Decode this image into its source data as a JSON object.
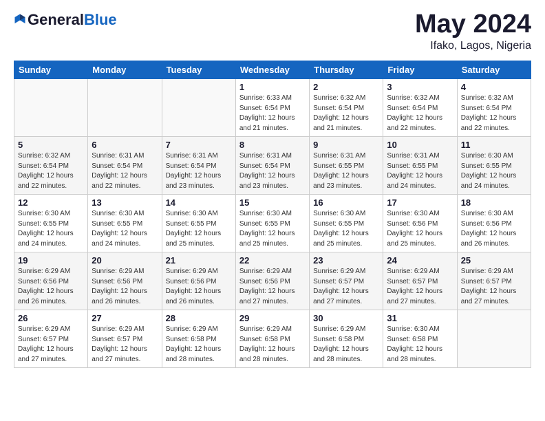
{
  "header": {
    "logo_general": "General",
    "logo_blue": "Blue",
    "title": "May 2024",
    "location": "Ifako, Lagos, Nigeria"
  },
  "days_of_week": [
    "Sunday",
    "Monday",
    "Tuesday",
    "Wednesday",
    "Thursday",
    "Friday",
    "Saturday"
  ],
  "weeks": [
    [
      {
        "day": "",
        "info": ""
      },
      {
        "day": "",
        "info": ""
      },
      {
        "day": "",
        "info": ""
      },
      {
        "day": "1",
        "info": "Sunrise: 6:33 AM\nSunset: 6:54 PM\nDaylight: 12 hours\nand 21 minutes."
      },
      {
        "day": "2",
        "info": "Sunrise: 6:32 AM\nSunset: 6:54 PM\nDaylight: 12 hours\nand 21 minutes."
      },
      {
        "day": "3",
        "info": "Sunrise: 6:32 AM\nSunset: 6:54 PM\nDaylight: 12 hours\nand 22 minutes."
      },
      {
        "day": "4",
        "info": "Sunrise: 6:32 AM\nSunset: 6:54 PM\nDaylight: 12 hours\nand 22 minutes."
      }
    ],
    [
      {
        "day": "5",
        "info": "Sunrise: 6:32 AM\nSunset: 6:54 PM\nDaylight: 12 hours\nand 22 minutes."
      },
      {
        "day": "6",
        "info": "Sunrise: 6:31 AM\nSunset: 6:54 PM\nDaylight: 12 hours\nand 22 minutes."
      },
      {
        "day": "7",
        "info": "Sunrise: 6:31 AM\nSunset: 6:54 PM\nDaylight: 12 hours\nand 23 minutes."
      },
      {
        "day": "8",
        "info": "Sunrise: 6:31 AM\nSunset: 6:54 PM\nDaylight: 12 hours\nand 23 minutes."
      },
      {
        "day": "9",
        "info": "Sunrise: 6:31 AM\nSunset: 6:55 PM\nDaylight: 12 hours\nand 23 minutes."
      },
      {
        "day": "10",
        "info": "Sunrise: 6:31 AM\nSunset: 6:55 PM\nDaylight: 12 hours\nand 24 minutes."
      },
      {
        "day": "11",
        "info": "Sunrise: 6:30 AM\nSunset: 6:55 PM\nDaylight: 12 hours\nand 24 minutes."
      }
    ],
    [
      {
        "day": "12",
        "info": "Sunrise: 6:30 AM\nSunset: 6:55 PM\nDaylight: 12 hours\nand 24 minutes."
      },
      {
        "day": "13",
        "info": "Sunrise: 6:30 AM\nSunset: 6:55 PM\nDaylight: 12 hours\nand 24 minutes."
      },
      {
        "day": "14",
        "info": "Sunrise: 6:30 AM\nSunset: 6:55 PM\nDaylight: 12 hours\nand 25 minutes."
      },
      {
        "day": "15",
        "info": "Sunrise: 6:30 AM\nSunset: 6:55 PM\nDaylight: 12 hours\nand 25 minutes."
      },
      {
        "day": "16",
        "info": "Sunrise: 6:30 AM\nSunset: 6:55 PM\nDaylight: 12 hours\nand 25 minutes."
      },
      {
        "day": "17",
        "info": "Sunrise: 6:30 AM\nSunset: 6:56 PM\nDaylight: 12 hours\nand 25 minutes."
      },
      {
        "day": "18",
        "info": "Sunrise: 6:30 AM\nSunset: 6:56 PM\nDaylight: 12 hours\nand 26 minutes."
      }
    ],
    [
      {
        "day": "19",
        "info": "Sunrise: 6:29 AM\nSunset: 6:56 PM\nDaylight: 12 hours\nand 26 minutes."
      },
      {
        "day": "20",
        "info": "Sunrise: 6:29 AM\nSunset: 6:56 PM\nDaylight: 12 hours\nand 26 minutes."
      },
      {
        "day": "21",
        "info": "Sunrise: 6:29 AM\nSunset: 6:56 PM\nDaylight: 12 hours\nand 26 minutes."
      },
      {
        "day": "22",
        "info": "Sunrise: 6:29 AM\nSunset: 6:56 PM\nDaylight: 12 hours\nand 27 minutes."
      },
      {
        "day": "23",
        "info": "Sunrise: 6:29 AM\nSunset: 6:57 PM\nDaylight: 12 hours\nand 27 minutes."
      },
      {
        "day": "24",
        "info": "Sunrise: 6:29 AM\nSunset: 6:57 PM\nDaylight: 12 hours\nand 27 minutes."
      },
      {
        "day": "25",
        "info": "Sunrise: 6:29 AM\nSunset: 6:57 PM\nDaylight: 12 hours\nand 27 minutes."
      }
    ],
    [
      {
        "day": "26",
        "info": "Sunrise: 6:29 AM\nSunset: 6:57 PM\nDaylight: 12 hours\nand 27 minutes."
      },
      {
        "day": "27",
        "info": "Sunrise: 6:29 AM\nSunset: 6:57 PM\nDaylight: 12 hours\nand 27 minutes."
      },
      {
        "day": "28",
        "info": "Sunrise: 6:29 AM\nSunset: 6:58 PM\nDaylight: 12 hours\nand 28 minutes."
      },
      {
        "day": "29",
        "info": "Sunrise: 6:29 AM\nSunset: 6:58 PM\nDaylight: 12 hours\nand 28 minutes."
      },
      {
        "day": "30",
        "info": "Sunrise: 6:29 AM\nSunset: 6:58 PM\nDaylight: 12 hours\nand 28 minutes."
      },
      {
        "day": "31",
        "info": "Sunrise: 6:30 AM\nSunset: 6:58 PM\nDaylight: 12 hours\nand 28 minutes."
      },
      {
        "day": "",
        "info": ""
      }
    ]
  ]
}
